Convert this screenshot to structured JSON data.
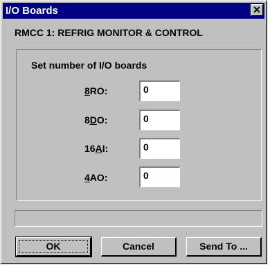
{
  "window": {
    "title": "I/O Boards",
    "close_glyph": "✕"
  },
  "subtitle": "RMCC 1: REFRIG MONITOR & CONTROL",
  "group": {
    "label": "Set number of I/O boards",
    "rows": [
      {
        "mnemonic": "8",
        "rest": "RO:",
        "value": "0"
      },
      {
        "prefix": "8",
        "mnemonic": "D",
        "rest": "O:",
        "value": "0"
      },
      {
        "prefix": "16",
        "mnemonic": "A",
        "rest": "I:",
        "value": "0"
      },
      {
        "mnemonic": "4",
        "rest": "AO:",
        "value": "0"
      }
    ]
  },
  "status_text": "",
  "buttons": {
    "ok": "OK",
    "cancel": "Cancel",
    "send_to": "Send To ..."
  }
}
